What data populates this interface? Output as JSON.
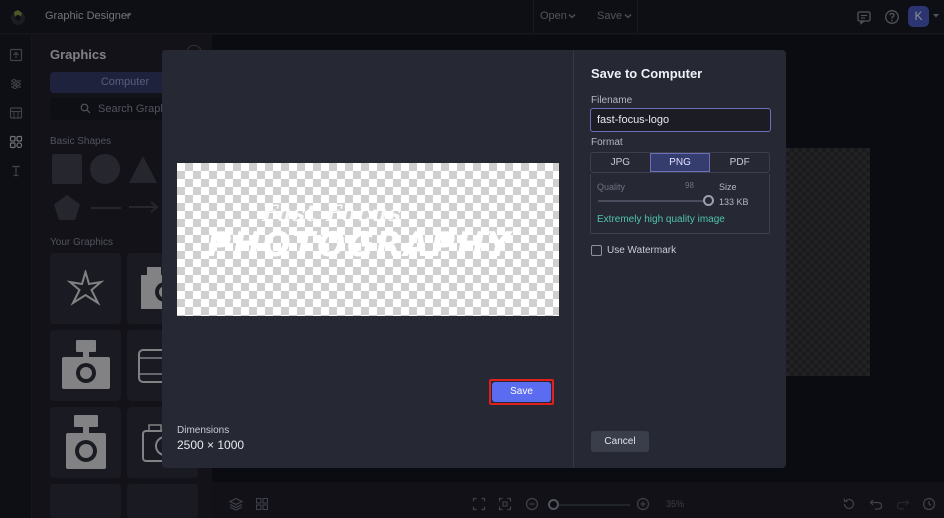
{
  "topbar": {
    "app_title": "Graphic Designer",
    "open_label": "Open",
    "save_label": "Save",
    "avatar_letter": "K"
  },
  "rail": {
    "icons": [
      "upload-icon",
      "adjust-icon",
      "table-icon",
      "graphics-icon",
      "text-icon"
    ]
  },
  "sidebar": {
    "title": "Graphics",
    "active_tab": "Computer",
    "search_placeholder": "Search Graphics",
    "basic_shapes_heading": "Basic Shapes",
    "your_graphics_heading": "Your Graphics"
  },
  "canvas": {
    "zoom": "35%"
  },
  "dialog": {
    "title": "Save to Computer",
    "filename_label": "Filename",
    "filename_value": "fast-focus-logo",
    "format_label": "Format",
    "formats": [
      "JPG",
      "PNG",
      "PDF"
    ],
    "selected_format": "PNG",
    "quality_label": "Quality",
    "quality_value": "98",
    "quality_fraction": 0.98,
    "size_label": "Size",
    "size_value": "133 KB",
    "quality_note": "Extremely high quality image",
    "watermark_label": "Use Watermark",
    "watermark_checked": false,
    "dimensions_label": "Dimensions",
    "dimensions_value": "2500 × 1000",
    "preview_line1": "Fast Focus",
    "preview_line2": "PHOTOGRAPHY",
    "cancel_label": "Cancel",
    "save_label": "Save"
  },
  "colors": {
    "accent": "#5b6cf0",
    "highlight_ring": "#e0201c",
    "quality_note": "#4fc3b0",
    "avatar": "#4a5cc7"
  }
}
